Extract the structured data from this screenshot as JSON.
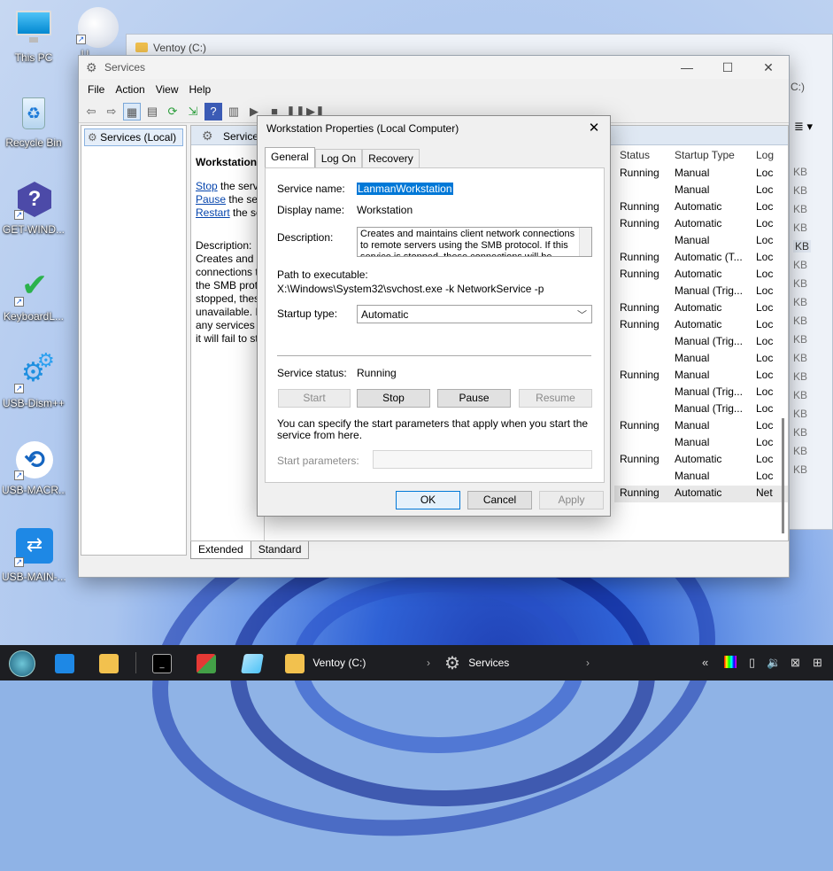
{
  "desktop": {
    "icons": [
      {
        "label": "This PC"
      },
      {
        "label": "U"
      },
      {
        "label": "Recycle Bin"
      },
      {
        "label": "GET-WIND..."
      },
      {
        "label": "KeyboardL..."
      },
      {
        "label": "USB-Dism++"
      },
      {
        "label": "USB-MACR..."
      },
      {
        "label": "USB-MAIN-..."
      }
    ]
  },
  "explorer_window": {
    "title": "Ventoy (C:)",
    "side_text": "C:)",
    "kb": [
      "KB",
      "KB",
      "KB",
      "KB",
      "KB",
      "KB",
      "KB",
      "KB",
      "KB",
      "KB",
      "KB",
      "KB",
      "KB",
      "KB",
      "KB",
      "KB",
      "KB"
    ]
  },
  "services_window": {
    "title": "Services",
    "menu": [
      "File",
      "Action",
      "View",
      "Help"
    ],
    "tree_item": "Services (Local)",
    "pane_header": "Services",
    "left_desc": {
      "heading": "Workstation",
      "stop_link": "Stop",
      "stop_rest": " the servi",
      "pause_link": "Pause",
      "pause_rest": " the ser",
      "restart_link": "Restart",
      "restart_rest": " the se",
      "desc_lines": [
        "Description:",
        "Creates and m",
        "connections t",
        "the SMB proto",
        "stopped, thes",
        "unavailable. If",
        "any services t",
        "it will fail to st"
      ]
    },
    "columns": {
      "status": "Status",
      "startup": "Startup Type",
      "log": "Log"
    },
    "rows": [
      {
        "status": "Running",
        "startup": "Manual",
        "log": "Loc"
      },
      {
        "status": "",
        "startup": "Manual",
        "log": "Loc"
      },
      {
        "status": "Running",
        "startup": "Automatic",
        "log": "Loc"
      },
      {
        "status": "Running",
        "startup": "Automatic",
        "log": "Loc"
      },
      {
        "status": "",
        "startup": "Manual",
        "log": "Loc"
      },
      {
        "status": "Running",
        "startup": "Automatic (T...",
        "log": "Loc"
      },
      {
        "status": "Running",
        "startup": "Automatic",
        "log": "Loc"
      },
      {
        "status": "",
        "startup": "Manual (Trig...",
        "log": "Loc"
      },
      {
        "status": "Running",
        "startup": "Automatic",
        "log": "Loc"
      },
      {
        "status": "Running",
        "startup": "Automatic",
        "log": "Loc"
      },
      {
        "status": "",
        "startup": "Manual (Trig...",
        "log": "Loc"
      },
      {
        "status": "",
        "startup": "Manual",
        "log": "Loc"
      },
      {
        "status": "Running",
        "startup": "Manual",
        "log": "Loc"
      },
      {
        "status": "",
        "startup": "Manual (Trig...",
        "log": "Loc"
      },
      {
        "status": "",
        "startup": "Manual (Trig...",
        "log": "Loc"
      },
      {
        "status": "Running",
        "startup": "Manual",
        "log": "Loc"
      },
      {
        "status": "",
        "startup": "Manual",
        "log": "Loc"
      },
      {
        "status": "Running",
        "startup": "Automatic",
        "log": "Loc"
      },
      {
        "status": "",
        "startup": "Manual",
        "log": "Loc"
      },
      {
        "status": "Running",
        "startup": "Automatic",
        "log": "Net"
      }
    ],
    "bottom_tabs": [
      "Extended",
      "Standard"
    ]
  },
  "dialog": {
    "title": "Workstation Properties (Local Computer)",
    "tabs": [
      "General",
      "Log On",
      "Recovery"
    ],
    "service_name_label": "Service name:",
    "service_name": "LanmanWorkstation",
    "display_name_label": "Display name:",
    "display_name": "Workstation",
    "description_label": "Description:",
    "description": "Creates and maintains client network connections to remote servers using the SMB protocol. If this service is stopped, these connections will be",
    "path_label": "Path to executable:",
    "path": "X:\\Windows\\System32\\svchost.exe -k NetworkService -p",
    "startup_type_label": "Startup type:",
    "startup_type": "Automatic",
    "status_label": "Service status:",
    "status": "Running",
    "buttons": {
      "start": "Start",
      "stop": "Stop",
      "pause": "Pause",
      "resume": "Resume"
    },
    "hint": "You can specify the start parameters that apply when you start the service from here.",
    "start_params_label": "Start parameters:",
    "ok": "OK",
    "cancel": "Cancel",
    "apply": "Apply"
  },
  "taskbar": {
    "items": [
      {
        "label": "Ventoy (C:)"
      },
      {
        "label": "Services"
      }
    ]
  }
}
